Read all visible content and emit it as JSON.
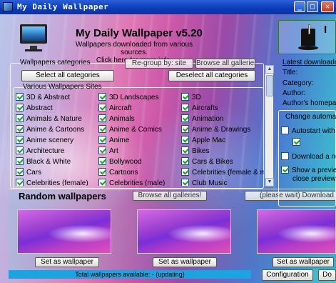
{
  "window": {
    "title": "My Daily Wallpaper",
    "minimize": "_",
    "maximize": "□",
    "close": "✕"
  },
  "header": {
    "app_title": "My Daily Wallpaper v5.20",
    "subtitle_line1": "Wallpapers downloaded from various sources.",
    "subtitle_line2": "Click here for more info."
  },
  "categories": {
    "group_label": "Wallpapers categories",
    "regroup_label": "Re-group by: site",
    "browse_all_label": "Browse all galleries!",
    "select_all_label": "Select all categories",
    "deselect_all_label": "Deselect all categories",
    "sites_label": "Various Wallpapers Sites",
    "items": [
      {
        "label": "3D & Abstract",
        "checked": true
      },
      {
        "label": "3D Landscapes",
        "checked": true
      },
      {
        "label": "3D",
        "checked": true
      },
      {
        "label": "Abstract",
        "checked": true
      },
      {
        "label": "Aircraft",
        "checked": true
      },
      {
        "label": "Aircrafts",
        "checked": true
      },
      {
        "label": "Animals & Nature",
        "checked": true
      },
      {
        "label": "Animals",
        "checked": true
      },
      {
        "label": "Animation",
        "checked": true
      },
      {
        "label": "Anime & Cartoons",
        "checked": true
      },
      {
        "label": "Anime & Comics",
        "checked": true
      },
      {
        "label": "Anime & Drawings",
        "checked": true
      },
      {
        "label": "Anime scenery",
        "checked": true
      },
      {
        "label": "Anime",
        "checked": true
      },
      {
        "label": "Apple Mac",
        "checked": true
      },
      {
        "label": "Architecture",
        "checked": true
      },
      {
        "label": "Art",
        "checked": true
      },
      {
        "label": "Bikes",
        "checked": true
      },
      {
        "label": "Black & White",
        "checked": true
      },
      {
        "label": "Bollywood",
        "checked": true
      },
      {
        "label": "Cars & Bikes",
        "checked": true
      },
      {
        "label": "Cars",
        "checked": true
      },
      {
        "label": "Cartoons",
        "checked": true
      },
      {
        "label": "Celebrities (female & male)",
        "checked": true
      },
      {
        "label": "Celebrities (female)",
        "checked": true
      },
      {
        "label": "Celebrities (male)",
        "checked": true
      },
      {
        "label": "Club Music",
        "checked": true
      }
    ]
  },
  "random": {
    "title": "Random wallpapers",
    "browse_all_label": "Browse all galleries!",
    "download_label": "(please wait) Download next c",
    "set_label": "Set as wallpaper",
    "status": "Total wallpapers available: - (updating)",
    "configuration_label": "Configuration",
    "close_label": "Do"
  },
  "right": {
    "title_letter": "I",
    "latest_link": "Latest downloaded w",
    "title_label": "Title:",
    "category_label": "Category:",
    "author_label": "Author:",
    "homepage_label": "Author's homepage:",
    "change_group_label": "Change automatica",
    "autostart_label": "Autostart with Wi",
    "download_new_label": "Download a new",
    "preview_line1": "Show a preview li",
    "preview_line2": "close preview an"
  }
}
